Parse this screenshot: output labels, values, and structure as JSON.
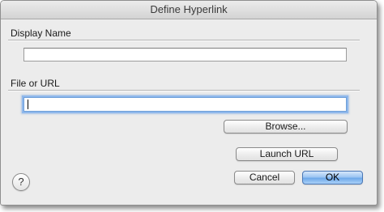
{
  "window": {
    "title": "Define Hyperlink"
  },
  "display_name": {
    "label": "Display Name",
    "value": "",
    "placeholder": ""
  },
  "file_or_url": {
    "label": "File or URL",
    "value": "",
    "placeholder": ""
  },
  "buttons": {
    "browse": "Browse...",
    "launch_url": "Launch URL",
    "cancel": "Cancel",
    "ok": "OK"
  },
  "help": {
    "icon": "question-mark-icon",
    "glyph": "?"
  },
  "colors": {
    "dialog_background": "#ececec",
    "focus_ring": "#8fb8ec",
    "default_button": "#6fa9e9"
  }
}
